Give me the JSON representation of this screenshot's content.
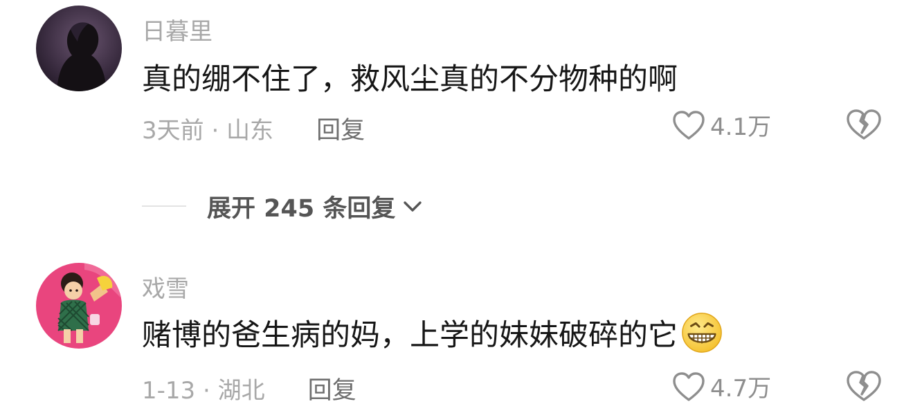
{
  "comments": [
    {
      "username": "日暮里",
      "text": "真的绷不住了，救风尘真的不分物种的啊",
      "meta": "3天前 · 山东",
      "reply": "回复",
      "likes": "4.1万",
      "avatar_icon": "person-silhouette-icon"
    },
    {
      "username": "戏雪",
      "text": "赌博的爸生病的妈，上学的妹妹破碎的它",
      "emoji": "grinning-face-icon",
      "meta": "1-13 · 湖北",
      "reply": "回复",
      "likes": "4.7万",
      "avatar_icon": "cartoon-girl-icon"
    }
  ],
  "expand_replies": "展开 245 条回复",
  "colors": {
    "text_primary": "#161616",
    "text_secondary": "#a8a8a8",
    "icon": "#8e8e8e"
  }
}
